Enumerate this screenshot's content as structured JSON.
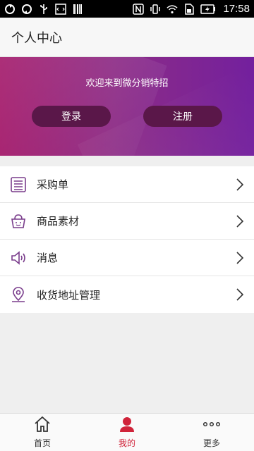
{
  "status_bar": {
    "time": "17:58"
  },
  "header": {
    "title": "个人中心"
  },
  "banner": {
    "welcome": "欢迎来到微分销特招",
    "login_label": "登录",
    "register_label": "注册"
  },
  "menu": {
    "items": [
      {
        "label": "采购单",
        "icon": "purchase-list-icon"
      },
      {
        "label": "商品素材",
        "icon": "goods-basket-icon"
      },
      {
        "label": "消息",
        "icon": "speaker-icon"
      },
      {
        "label": "收货地址管理",
        "icon": "location-pin-icon"
      }
    ]
  },
  "bottom_nav": {
    "home_label": "首页",
    "mine_label": "我的",
    "more_label": "更多"
  },
  "colors": {
    "accent": "#d0243a",
    "banner_start": "#a3196a",
    "banner_end": "#73209e",
    "button_bg": "#5a1749",
    "icon_purple": "#7a3d8c"
  }
}
